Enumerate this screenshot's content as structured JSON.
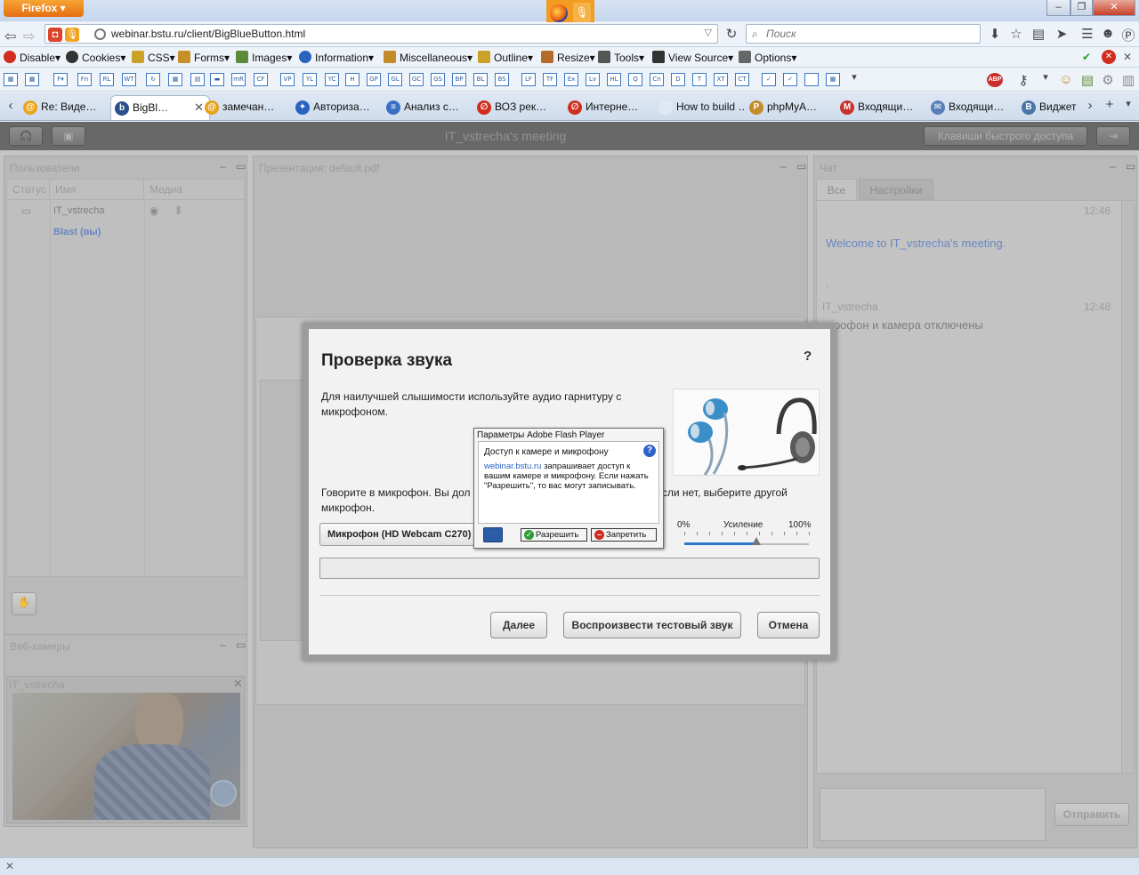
{
  "browser": {
    "menu_button": "Firefox",
    "window_controls": [
      "–",
      "❐",
      "✕"
    ],
    "url": "webinar.bstu.ru/client/BigBlueButton.html",
    "search_placeholder": "Поиск"
  },
  "webdev_toolbar": [
    {
      "label": "Disable▾",
      "color": "#d12d1e"
    },
    {
      "label": "Cookies▾",
      "color": "#333333"
    },
    {
      "label": "CSS▾",
      "color": "#c9a227"
    },
    {
      "label": "Forms▾",
      "color": "#c98f27"
    },
    {
      "label": "Images▾",
      "color": "#5d8a3a"
    },
    {
      "label": "Information▾",
      "color": "#2a62c0"
    },
    {
      "label": "Miscellaneous▾",
      "color": "#c48b2a"
    },
    {
      "label": "Outline▾",
      "color": "#c9a227"
    },
    {
      "label": "Resize▾",
      "color": "#b56b2a"
    },
    {
      "label": "Tools▾",
      "color": "#555555"
    },
    {
      "label": "View Source▾",
      "color": "#333333"
    },
    {
      "label": "Options▾",
      "color": "#666666"
    }
  ],
  "icon_toolbar": [
    "F▾",
    "Fn",
    "RL",
    "WT",
    "↻",
    "▦",
    "▤",
    "▬",
    "mR",
    "CF",
    "VP",
    "YL",
    "YC",
    "H",
    "GP",
    "GL",
    "GC",
    "GS",
    "BP",
    "BL",
    "BS",
    "LF",
    "TF",
    "Ex",
    "Lv",
    "HL",
    "Q",
    "Cn",
    "D",
    "T",
    "XT",
    "CT",
    "✓",
    "✓",
    "",
    "▦"
  ],
  "tabs": [
    {
      "label": "Re: Виде…",
      "fav_color": "#e8a31a",
      "fav": "@"
    },
    {
      "label": "BigBl…",
      "fav_color": "#2b4f8c",
      "fav": "b",
      "active": true
    },
    {
      "label": "замечан…",
      "fav_color": "#e8a31a",
      "fav": "@"
    },
    {
      "label": "Авториза…",
      "fav_color": "#2a62c0",
      "fav": "✦"
    },
    {
      "label": "Анализ с…",
      "fav_color": "#3b6fc4",
      "fav": "≡"
    },
    {
      "label": "ВОЗ рек…",
      "fav_color": "#d12d1e",
      "fav": "∅"
    },
    {
      "label": "Интерне…",
      "fav_color": "#d12d1e",
      "fav": "∅"
    },
    {
      "label": "How to build …",
      "fav_color": "#dfe8f3",
      "fav": ""
    },
    {
      "label": "phpMyA…",
      "fav_color": "#c48b2a",
      "fav": "P"
    },
    {
      "label": "Входящи…",
      "fav_color": "#c9302c",
      "fav": "M"
    },
    {
      "label": "Входящи…",
      "fav_color": "#5a7fb8",
      "fav": "✉"
    },
    {
      "label": "Виджет …",
      "fav_color": "#4a76a8",
      "fav": "B"
    }
  ],
  "app": {
    "meeting_title": "IT_vstrecha's meeting",
    "shortcuts_button": "Клавиши быстрого доступа",
    "users_panel": {
      "title": "Пользователи",
      "columns": [
        "Статус",
        "Имя",
        "Медиа"
      ],
      "rows": [
        {
          "name": "IT_vstrecha",
          "is_you": false
        },
        {
          "name": "Blast (вы)",
          "is_you": true
        }
      ]
    },
    "presentation_panel": {
      "title": "Презентация: default.pdf"
    },
    "chat_panel": {
      "title": "Чат",
      "tabs": [
        "Все",
        "Настройки"
      ],
      "messages": [
        {
          "time": "12:46",
          "text": "Welcome to IT_vstrecha's meeting.",
          "style": "system"
        },
        {
          "time": "",
          "text": ".",
          "style": "plain"
        },
        {
          "time": "12:48",
          "sender": "IT_vstrecha",
          "text": "икрофон и камера отключены",
          "style": "user"
        }
      ],
      "send_button": "Отправить"
    },
    "webcams_panel": {
      "title": "Веб-камеры",
      "video_title": "IT_vstrecha"
    }
  },
  "audio_dialog": {
    "title": "Проверка звука",
    "help": "?",
    "text1": "Для наилучшей слышимости используйте аудио гарнитуру с микрофоном.",
    "text2_left": "Говорите в микрофон. Вы дол",
    "text2_right": "Если нет, выберите другой",
    "text2_line2": "микрофон.",
    "mic_select": "Микрофон (HD Webcam C270)",
    "gain": {
      "min_label": "0%",
      "label": "Усиление",
      "max_label": "100%",
      "value": 0.58
    },
    "buttons": {
      "next": "Далее",
      "play_test": "Воспроизвести тестовый звук",
      "cancel": "Отмена"
    }
  },
  "flash_popup": {
    "title": "Параметры Adobe Flash Player",
    "heading": "Доступ к камере и микрофону",
    "help": "?",
    "domain": "webinar.bstu.ru",
    "message": " запрашивает доступ к вашим камере и микрофону. Если нажать \"Разрешить\", то вас могут записывать.",
    "allow": "Разрешить",
    "deny": "Запретить"
  },
  "colors": {
    "accent_blue": "#2e77c9",
    "chat_system": "#5f83c4",
    "you_name": "#5f7fc6"
  }
}
